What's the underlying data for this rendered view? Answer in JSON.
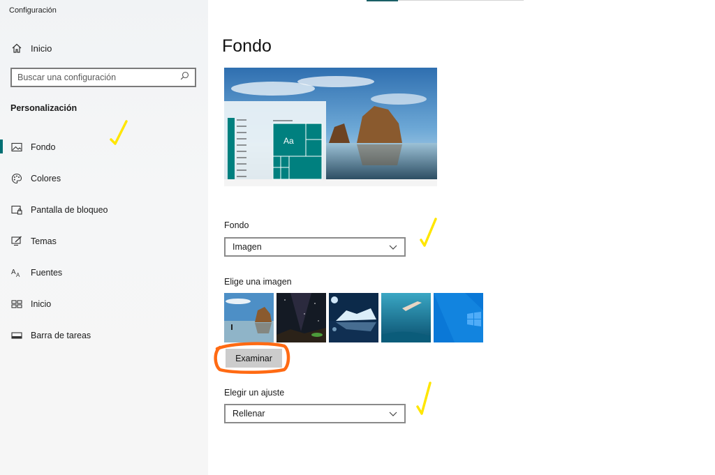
{
  "window": {
    "title": "Configuración"
  },
  "sidebar": {
    "home_label": "Inicio",
    "search_placeholder": "Buscar una configuración",
    "section_title": "Personalización",
    "items": [
      {
        "label": "Fondo",
        "icon": "picture-icon",
        "active": true
      },
      {
        "label": "Colores",
        "icon": "palette-icon",
        "active": false
      },
      {
        "label": "Pantalla de bloqueo",
        "icon": "lock-screen-icon",
        "active": false
      },
      {
        "label": "Temas",
        "icon": "themes-icon",
        "active": false
      },
      {
        "label": "Fuentes",
        "icon": "fonts-icon",
        "active": false
      },
      {
        "label": "Inicio",
        "icon": "start-icon",
        "active": false
      },
      {
        "label": "Barra de tareas",
        "icon": "taskbar-icon",
        "active": false
      }
    ]
  },
  "main": {
    "title": "Fondo",
    "preview": {
      "sample_text": "Aa"
    },
    "background": {
      "label": "Fondo",
      "value": "Imagen"
    },
    "choose_image": {
      "label": "Elige una imagen",
      "thumbnails": [
        "beach-rocks",
        "night-sky",
        "ice-island",
        "underwater-swimmer",
        "windows-logo"
      ]
    },
    "browse_button": "Examinar",
    "fit": {
      "label": "Elegir un ajuste",
      "value": "Rellenar"
    }
  },
  "colors": {
    "accent": "#00807f",
    "sidebar_bg": "#f2f3f4",
    "annotation_yellow": "#ffe600",
    "annotation_orange": "#ff6a13"
  }
}
